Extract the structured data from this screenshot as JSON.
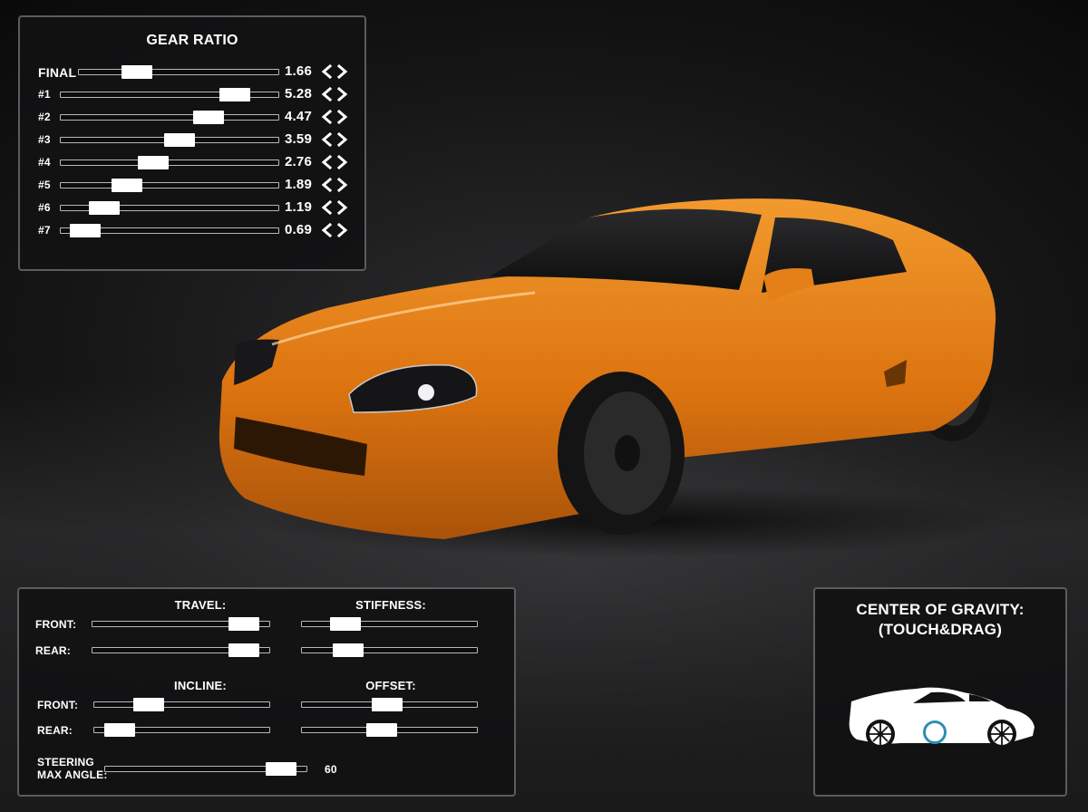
{
  "gear_ratio": {
    "title": "GEAR RATIO",
    "rows": [
      {
        "label": "FINAL",
        "value": "1.66",
        "level": 0.25
      },
      {
        "label": "#1",
        "value": "5.28",
        "level": 0.84
      },
      {
        "label": "#2",
        "value": "4.47",
        "level": 0.7
      },
      {
        "label": "#3",
        "value": "3.59",
        "level": 0.55
      },
      {
        "label": "#4",
        "value": "2.76",
        "level": 0.41
      },
      {
        "label": "#5",
        "value": "1.89",
        "level": 0.27
      },
      {
        "label": "#6",
        "value": "1.19",
        "level": 0.15
      },
      {
        "label": "#7",
        "value": "0.69",
        "level": 0.05
      }
    ]
  },
  "suspension": {
    "travel": {
      "title": "TRAVEL:",
      "front": {
        "label": "FRONT:",
        "level": 0.92
      },
      "rear": {
        "label": "REAR:",
        "level": 0.92
      }
    },
    "stiffness": {
      "title": "STIFFNESS:",
      "front": {
        "label": "FRONT:",
        "level": 0.19
      },
      "rear": {
        "label": "REAR:",
        "level": 0.21
      }
    },
    "incline": {
      "title": "INCLINE:",
      "front": {
        "label": "FRONT:",
        "level": 0.27
      },
      "rear": {
        "label": "REAR:",
        "level": 0.07
      }
    },
    "offset": {
      "title": "OFFSET:",
      "front": {
        "label": "FRONT:",
        "level": 0.48
      },
      "rear": {
        "label": "REAR:",
        "level": 0.44
      }
    },
    "steering": {
      "label_line1": "STEERING",
      "label_line2": "MAX ANGLE:",
      "value": "60",
      "level": 0.93
    }
  },
  "center_of_gravity": {
    "title_line1": "CENTER OF GRAVITY:",
    "title_line2": "(TOUCH&DRAG)",
    "position": 0.46
  },
  "colors": {
    "car_body": "#e07a12",
    "cog_marker": "#2e8fb0"
  }
}
